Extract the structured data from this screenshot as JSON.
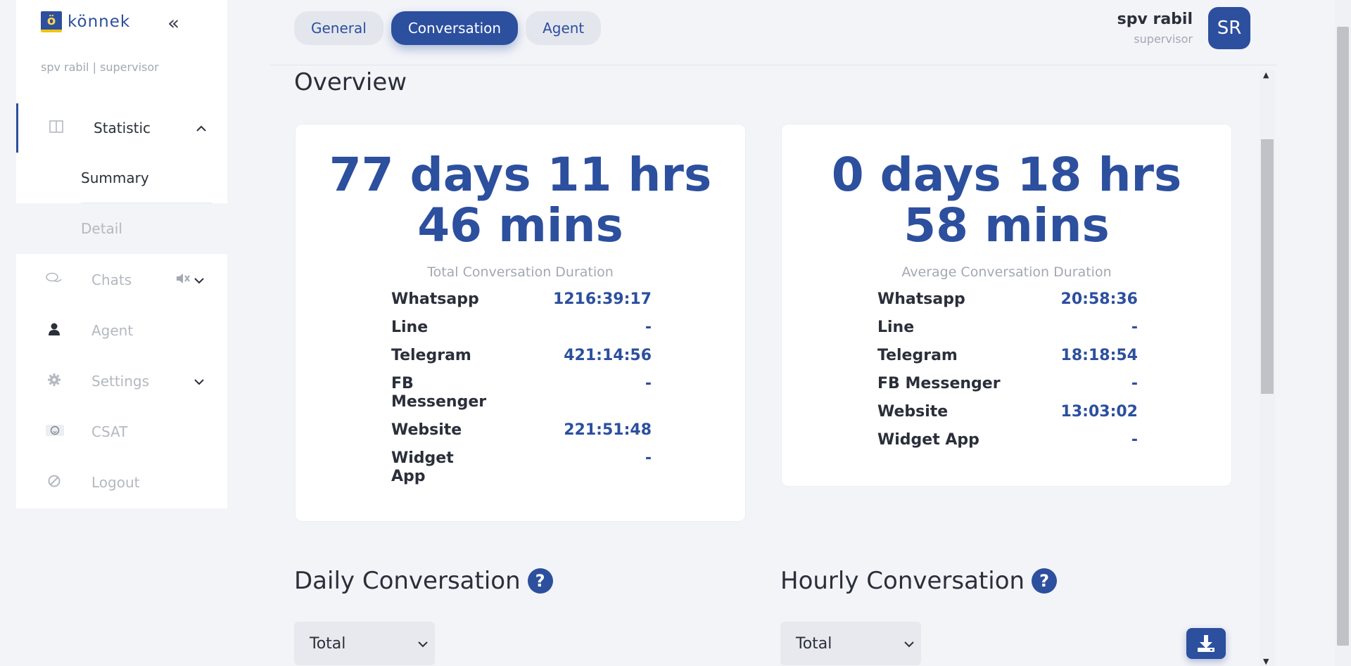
{
  "sidebar": {
    "brand_mark": "ö",
    "brand_text": "könnek",
    "collapse_icon": "«",
    "user_line": "spv rabil | supervisor",
    "items": [
      {
        "label": "Statistic",
        "icon": "columns-icon"
      },
      {
        "label": "Chats",
        "icon": "chat-bubbles-icon"
      },
      {
        "label": "Agent",
        "icon": "person-icon"
      },
      {
        "label": "Settings",
        "icon": "gear-icon"
      },
      {
        "label": "CSAT",
        "icon": "smiley-icon"
      },
      {
        "label": "Logout",
        "icon": "logout-icon"
      }
    ],
    "sub_items": [
      {
        "label": "Summary"
      },
      {
        "label": "Detail"
      }
    ]
  },
  "header": {
    "tabs": [
      {
        "label": "General",
        "active": false
      },
      {
        "label": "Conversation",
        "active": true
      },
      {
        "label": "Agent",
        "active": false
      }
    ],
    "profile_name": "spv rabil",
    "profile_role": "supervisor",
    "avatar_initials": "SR"
  },
  "overview": {
    "title": "Overview",
    "total": {
      "value": "77 days 11 hrs 46 mins",
      "caption": "Total Conversation Duration",
      "rows": [
        {
          "name": "Whatsapp",
          "value": "1216:39:17"
        },
        {
          "name": "Line",
          "value": "-"
        },
        {
          "name": "Telegram",
          "value": "421:14:56"
        },
        {
          "name": "FB Messenger",
          "value": "-"
        },
        {
          "name": "Website",
          "value": "221:51:48"
        },
        {
          "name": "Widget App",
          "value": "-"
        }
      ]
    },
    "average": {
      "value": "0 days 18 hrs 58 mins",
      "caption": "Average Conversation Duration",
      "rows": [
        {
          "name": "Whatsapp",
          "value": "20:58:36"
        },
        {
          "name": "Line",
          "value": "-"
        },
        {
          "name": "Telegram",
          "value": "18:18:54"
        },
        {
          "name": "FB Messenger",
          "value": "-"
        },
        {
          "name": "Website",
          "value": "13:03:02"
        },
        {
          "name": "Widget App",
          "value": "-"
        }
      ]
    }
  },
  "daily": {
    "title": "Daily Conversation",
    "select_value": "Total"
  },
  "hourly": {
    "title": "Hourly Conversation",
    "select_value": "Total"
  },
  "colors": {
    "accent": "#2c4f9e",
    "background": "#f3f4f8",
    "muted": "#a3a8b2"
  }
}
